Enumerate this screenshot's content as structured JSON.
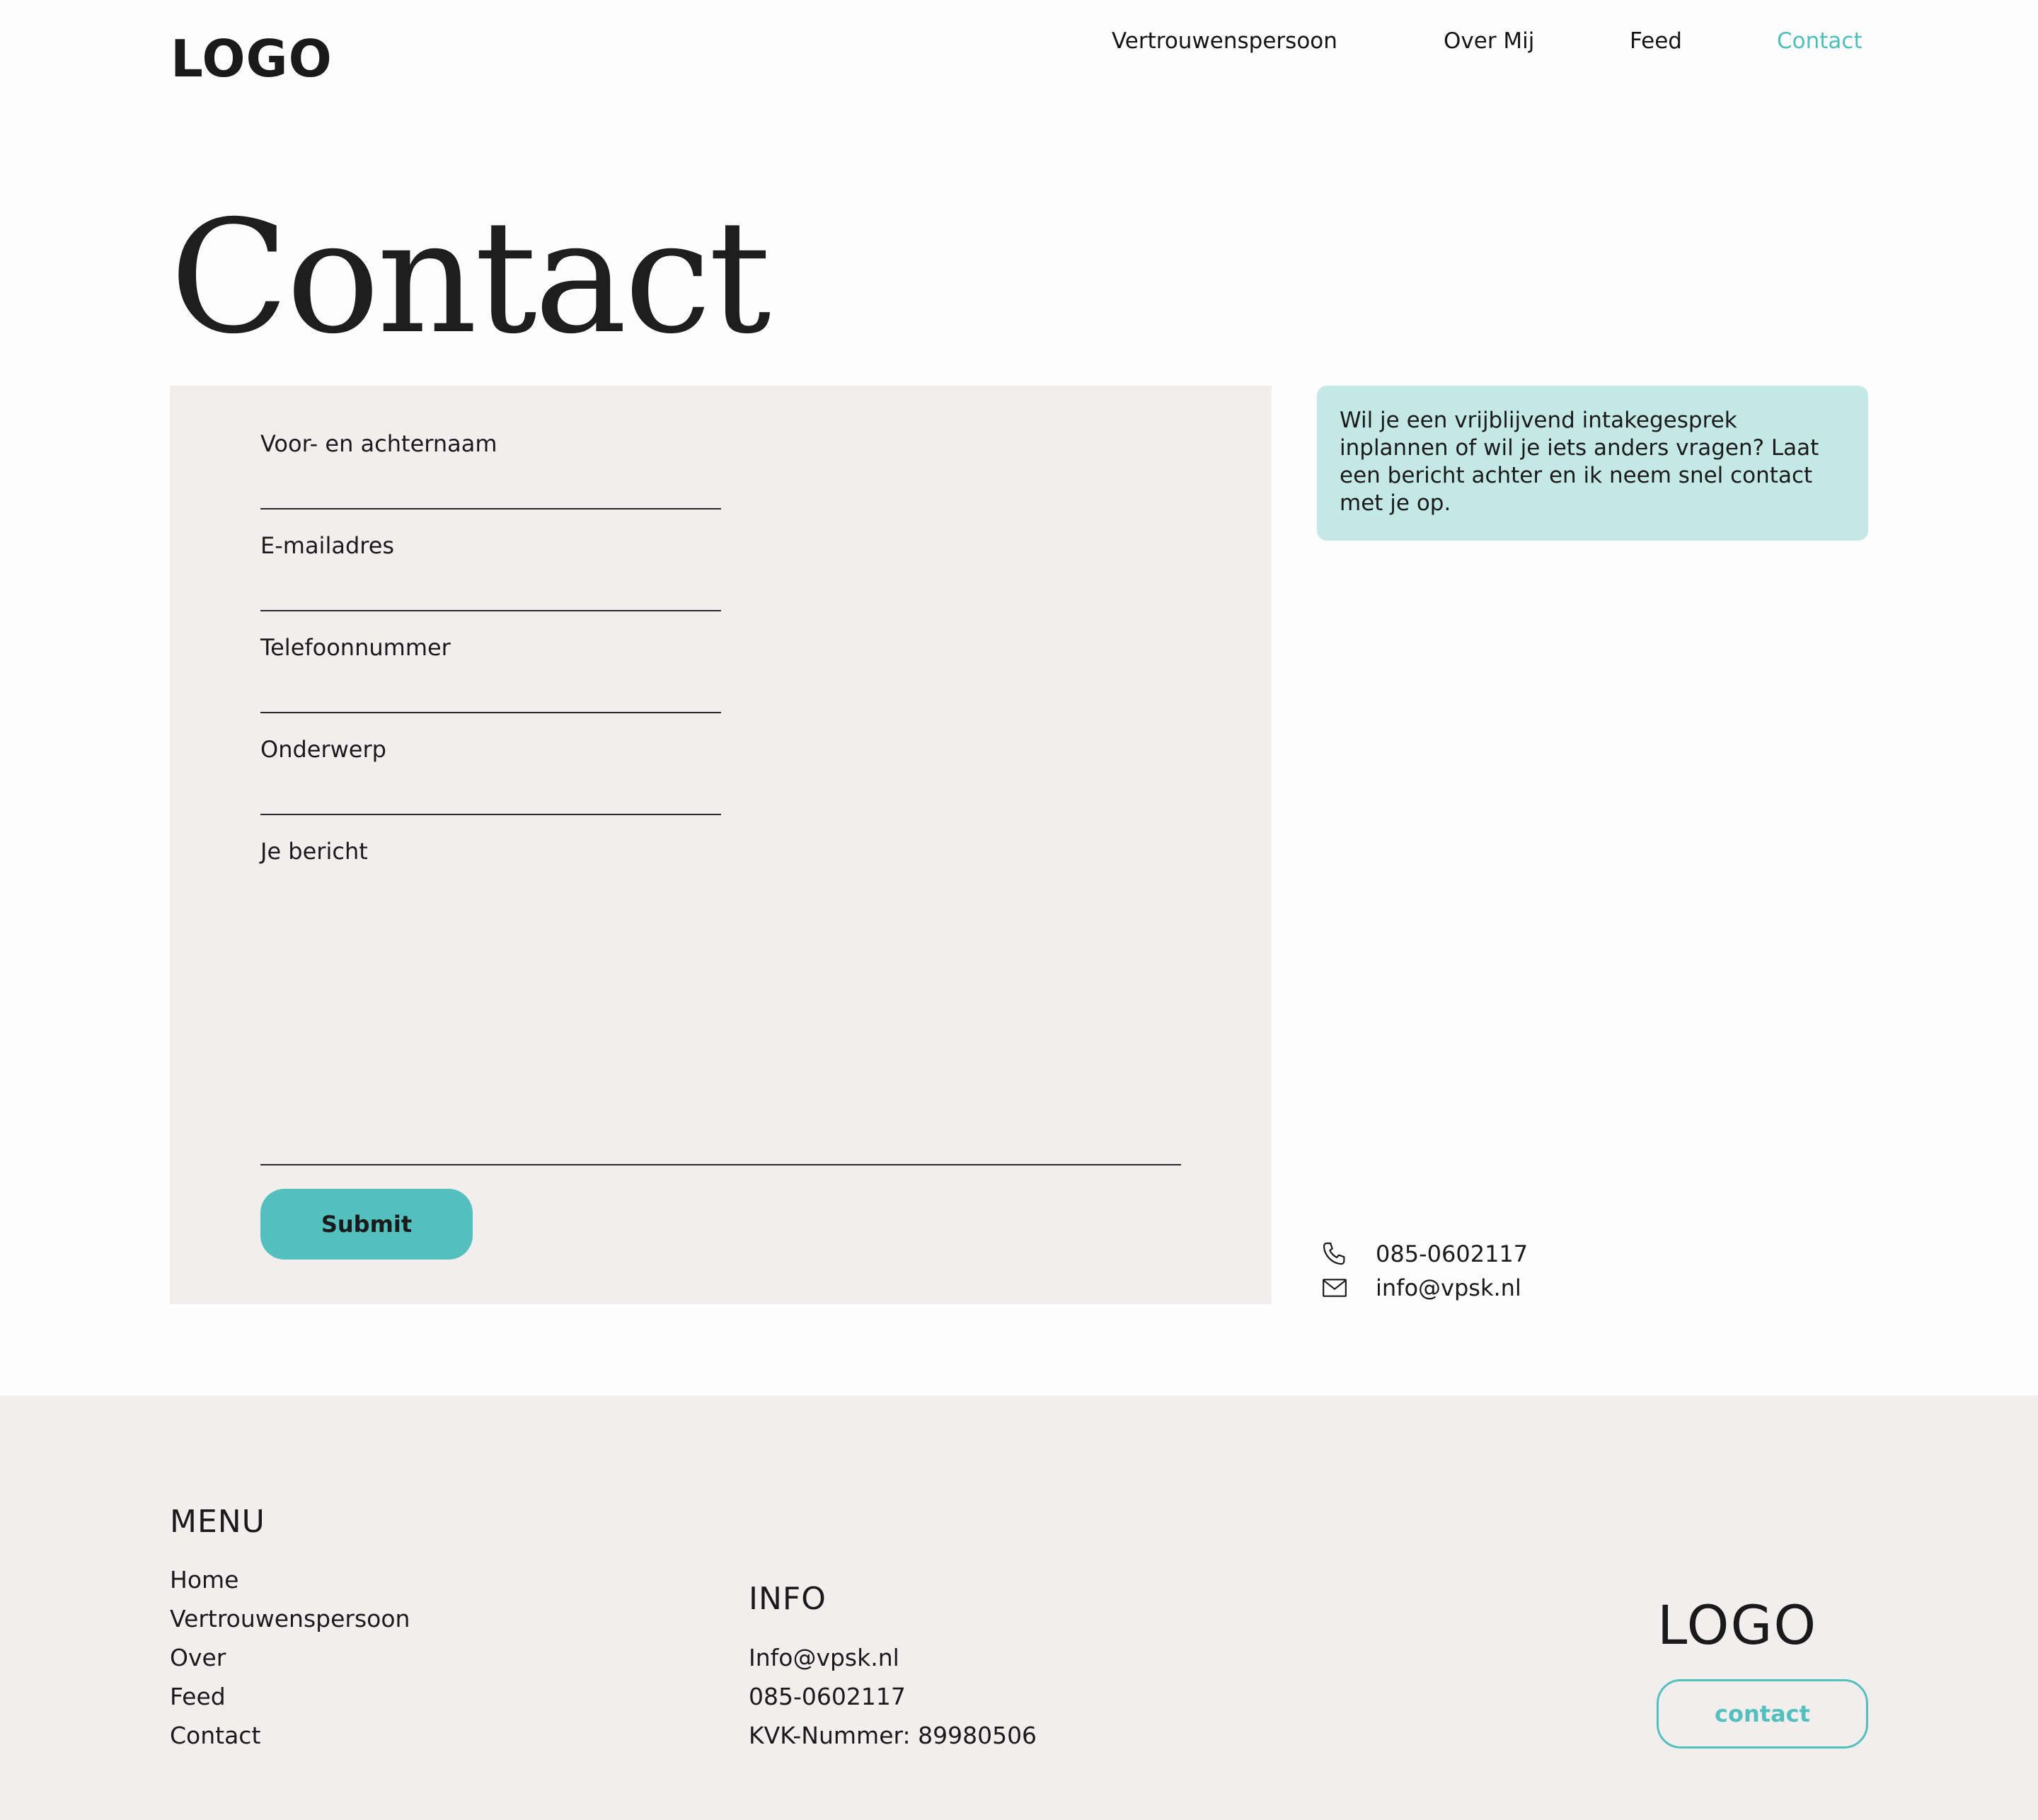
{
  "header": {
    "logo": "LOGO",
    "nav": [
      {
        "label": "Vertrouwenspersoon",
        "active": false
      },
      {
        "label": "Over Mij",
        "active": false
      },
      {
        "label": "Feed",
        "active": false
      },
      {
        "label": "Contact",
        "active": true
      }
    ]
  },
  "page_title": "Contact",
  "form": {
    "fields": [
      {
        "label": "Voor- en achternaam",
        "value": ""
      },
      {
        "label": "E-mailadres",
        "value": ""
      },
      {
        "label": "Telefoonnummer",
        "value": ""
      },
      {
        "label": "Onderwerp",
        "value": ""
      }
    ],
    "message_label": "Je bericht",
    "message_value": "",
    "submit_label": "Submit"
  },
  "info_text": "Wil je een vrijblijvend intakegesprek inplannen of wil je iets anders vragen? Laat een bericht achter en ik neem snel contact met je op.",
  "contact": {
    "phone": "085-0602117",
    "phone_icon": "phone-icon",
    "email": "info@vpsk.nl",
    "email_icon": "mail-icon"
  },
  "footer": {
    "menu_heading": "MENU",
    "menu_items": [
      "Home",
      "Vertrouwenspersoon",
      "Over",
      "Feed",
      "Contact"
    ],
    "info_heading": "INFO",
    "info_items": [
      "Info@vpsk.nl",
      "085-0602117",
      "KVK-Nummer: 89980506"
    ],
    "logo": "LOGO",
    "contact_button": "contact"
  },
  "colors": {
    "accent": "#54c0bd",
    "info_box": "#c4e8e6",
    "panel": "#f3eeee"
  }
}
